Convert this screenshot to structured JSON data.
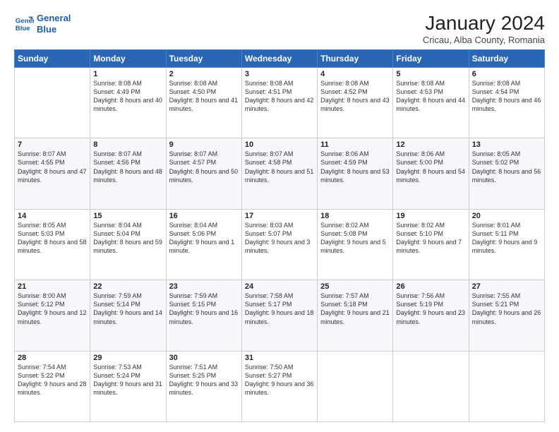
{
  "logo": {
    "line1": "General",
    "line2": "Blue"
  },
  "title": "January 2024",
  "subtitle": "Cricau, Alba County, Romania",
  "header": {
    "accent_color": "#2a66b3"
  },
  "days_of_week": [
    "Sunday",
    "Monday",
    "Tuesday",
    "Wednesday",
    "Thursday",
    "Friday",
    "Saturday"
  ],
  "weeks": [
    [
      {
        "day": "",
        "sunrise": "",
        "sunset": "",
        "daylight": ""
      },
      {
        "day": "1",
        "sunrise": "Sunrise: 8:08 AM",
        "sunset": "Sunset: 4:49 PM",
        "daylight": "Daylight: 8 hours and 40 minutes."
      },
      {
        "day": "2",
        "sunrise": "Sunrise: 8:08 AM",
        "sunset": "Sunset: 4:50 PM",
        "daylight": "Daylight: 8 hours and 41 minutes."
      },
      {
        "day": "3",
        "sunrise": "Sunrise: 8:08 AM",
        "sunset": "Sunset: 4:51 PM",
        "daylight": "Daylight: 8 hours and 42 minutes."
      },
      {
        "day": "4",
        "sunrise": "Sunrise: 8:08 AM",
        "sunset": "Sunset: 4:52 PM",
        "daylight": "Daylight: 8 hours and 43 minutes."
      },
      {
        "day": "5",
        "sunrise": "Sunrise: 8:08 AM",
        "sunset": "Sunset: 4:53 PM",
        "daylight": "Daylight: 8 hours and 44 minutes."
      },
      {
        "day": "6",
        "sunrise": "Sunrise: 8:08 AM",
        "sunset": "Sunset: 4:54 PM",
        "daylight": "Daylight: 8 hours and 46 minutes."
      }
    ],
    [
      {
        "day": "7",
        "sunrise": "Sunrise: 8:07 AM",
        "sunset": "Sunset: 4:55 PM",
        "daylight": "Daylight: 8 hours and 47 minutes."
      },
      {
        "day": "8",
        "sunrise": "Sunrise: 8:07 AM",
        "sunset": "Sunset: 4:56 PM",
        "daylight": "Daylight: 8 hours and 48 minutes."
      },
      {
        "day": "9",
        "sunrise": "Sunrise: 8:07 AM",
        "sunset": "Sunset: 4:57 PM",
        "daylight": "Daylight: 8 hours and 50 minutes."
      },
      {
        "day": "10",
        "sunrise": "Sunrise: 8:07 AM",
        "sunset": "Sunset: 4:58 PM",
        "daylight": "Daylight: 8 hours and 51 minutes."
      },
      {
        "day": "11",
        "sunrise": "Sunrise: 8:06 AM",
        "sunset": "Sunset: 4:59 PM",
        "daylight": "Daylight: 8 hours and 53 minutes."
      },
      {
        "day": "12",
        "sunrise": "Sunrise: 8:06 AM",
        "sunset": "Sunset: 5:00 PM",
        "daylight": "Daylight: 8 hours and 54 minutes."
      },
      {
        "day": "13",
        "sunrise": "Sunrise: 8:05 AM",
        "sunset": "Sunset: 5:02 PM",
        "daylight": "Daylight: 8 hours and 56 minutes."
      }
    ],
    [
      {
        "day": "14",
        "sunrise": "Sunrise: 8:05 AM",
        "sunset": "Sunset: 5:03 PM",
        "daylight": "Daylight: 8 hours and 58 minutes."
      },
      {
        "day": "15",
        "sunrise": "Sunrise: 8:04 AM",
        "sunset": "Sunset: 5:04 PM",
        "daylight": "Daylight: 8 hours and 59 minutes."
      },
      {
        "day": "16",
        "sunrise": "Sunrise: 8:04 AM",
        "sunset": "Sunset: 5:06 PM",
        "daylight": "Daylight: 9 hours and 1 minute."
      },
      {
        "day": "17",
        "sunrise": "Sunrise: 8:03 AM",
        "sunset": "Sunset: 5:07 PM",
        "daylight": "Daylight: 9 hours and 3 minutes."
      },
      {
        "day": "18",
        "sunrise": "Sunrise: 8:02 AM",
        "sunset": "Sunset: 5:08 PM",
        "daylight": "Daylight: 9 hours and 5 minutes."
      },
      {
        "day": "19",
        "sunrise": "Sunrise: 8:02 AM",
        "sunset": "Sunset: 5:10 PM",
        "daylight": "Daylight: 9 hours and 7 minutes."
      },
      {
        "day": "20",
        "sunrise": "Sunrise: 8:01 AM",
        "sunset": "Sunset: 5:11 PM",
        "daylight": "Daylight: 9 hours and 9 minutes."
      }
    ],
    [
      {
        "day": "21",
        "sunrise": "Sunrise: 8:00 AM",
        "sunset": "Sunset: 5:12 PM",
        "daylight": "Daylight: 9 hours and 12 minutes."
      },
      {
        "day": "22",
        "sunrise": "Sunrise: 7:59 AM",
        "sunset": "Sunset: 5:14 PM",
        "daylight": "Daylight: 9 hours and 14 minutes."
      },
      {
        "day": "23",
        "sunrise": "Sunrise: 7:59 AM",
        "sunset": "Sunset: 5:15 PM",
        "daylight": "Daylight: 9 hours and 16 minutes."
      },
      {
        "day": "24",
        "sunrise": "Sunrise: 7:58 AM",
        "sunset": "Sunset: 5:17 PM",
        "daylight": "Daylight: 9 hours and 18 minutes."
      },
      {
        "day": "25",
        "sunrise": "Sunrise: 7:57 AM",
        "sunset": "Sunset: 5:18 PM",
        "daylight": "Daylight: 9 hours and 21 minutes."
      },
      {
        "day": "26",
        "sunrise": "Sunrise: 7:56 AM",
        "sunset": "Sunset: 5:19 PM",
        "daylight": "Daylight: 9 hours and 23 minutes."
      },
      {
        "day": "27",
        "sunrise": "Sunrise: 7:55 AM",
        "sunset": "Sunset: 5:21 PM",
        "daylight": "Daylight: 9 hours and 26 minutes."
      }
    ],
    [
      {
        "day": "28",
        "sunrise": "Sunrise: 7:54 AM",
        "sunset": "Sunset: 5:22 PM",
        "daylight": "Daylight: 9 hours and 28 minutes."
      },
      {
        "day": "29",
        "sunrise": "Sunrise: 7:53 AM",
        "sunset": "Sunset: 5:24 PM",
        "daylight": "Daylight: 9 hours and 31 minutes."
      },
      {
        "day": "30",
        "sunrise": "Sunrise: 7:51 AM",
        "sunset": "Sunset: 5:25 PM",
        "daylight": "Daylight: 9 hours and 33 minutes."
      },
      {
        "day": "31",
        "sunrise": "Sunrise: 7:50 AM",
        "sunset": "Sunset: 5:27 PM",
        "daylight": "Daylight: 9 hours and 36 minutes."
      },
      {
        "day": "",
        "sunrise": "",
        "sunset": "",
        "daylight": ""
      },
      {
        "day": "",
        "sunrise": "",
        "sunset": "",
        "daylight": ""
      },
      {
        "day": "",
        "sunrise": "",
        "sunset": "",
        "daylight": ""
      }
    ]
  ]
}
